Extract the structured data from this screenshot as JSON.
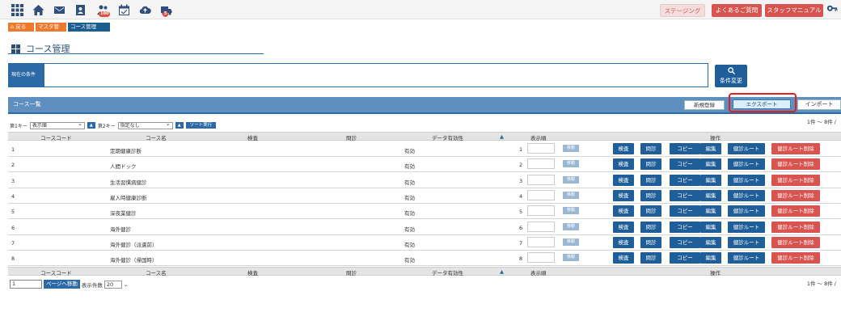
{
  "topbar": {
    "icons": [
      "grid-icon",
      "home-icon",
      "mail-icon",
      "contact-card-icon",
      "users-icon",
      "calendar-check-icon",
      "cloud-upload-icon",
      "truck-icon"
    ],
    "users_badge": "100",
    "truck_badge": "5",
    "staging_label": "ステージング",
    "faq_label": "よくあるご質問",
    "manual_label": "スタッフマニュアル"
  },
  "breadcrumb": {
    "back": "戻る",
    "master": "マスタ管理",
    "course": "コース管理"
  },
  "page_title": "コース管理",
  "condition": {
    "label": "現在の条件",
    "button_label": "条件変更"
  },
  "list": {
    "title": "コース一覧",
    "new_label": "新規登録",
    "export_label": "エクスポート",
    "import_label": "インポート",
    "count_top": "1件 ～ 8件 /",
    "count_bottom": "1件 ～ 8件 /"
  },
  "sort": {
    "key1_label": "第1キー",
    "key1_value": "表示順",
    "key2_label": "第2キー",
    "key2_value": "指定なし",
    "exec_label": "ソート実行"
  },
  "columns": {
    "code": "コースコード",
    "name": "コース名",
    "exam": "検査",
    "consult": "問診",
    "validity": "データ有効性",
    "order": "表示順",
    "ops": "操作"
  },
  "ops_labels": {
    "exam": "検査",
    "consult": "問診",
    "copy": "コピー",
    "edit": "編集",
    "route": "健診ルート",
    "route_delete": "健診ルート削除",
    "move": "移動"
  },
  "rows": [
    {
      "code": "1",
      "name": "定期健康診断",
      "validity": "有効",
      "order": "1"
    },
    {
      "code": "2",
      "name": "人間ドック",
      "validity": "有効",
      "order": "2"
    },
    {
      "code": "3",
      "name": "生活習慣病健診",
      "validity": "有効",
      "order": "3"
    },
    {
      "code": "4",
      "name": "雇入時健康診断",
      "validity": "有効",
      "order": "4"
    },
    {
      "code": "5",
      "name": "深夜業健診",
      "validity": "有効",
      "order": "5"
    },
    {
      "code": "6",
      "name": "海外健診",
      "validity": "有効",
      "order": "6"
    },
    {
      "code": "7",
      "name": "海外健診（派遣前）",
      "validity": "有効",
      "order": "7"
    },
    {
      "code": "8",
      "name": "海外健診（帰国時）",
      "validity": "有効",
      "order": "8"
    }
  ],
  "pager": {
    "page_value": "1",
    "go_label": "ページへ移動",
    "per_page_label": "表示件数",
    "per_page_value": "20"
  },
  "colors": {
    "primary": "#1f5e99",
    "danger": "#d9534f",
    "orange": "#ee7a2e",
    "highlight": "#e02020"
  }
}
